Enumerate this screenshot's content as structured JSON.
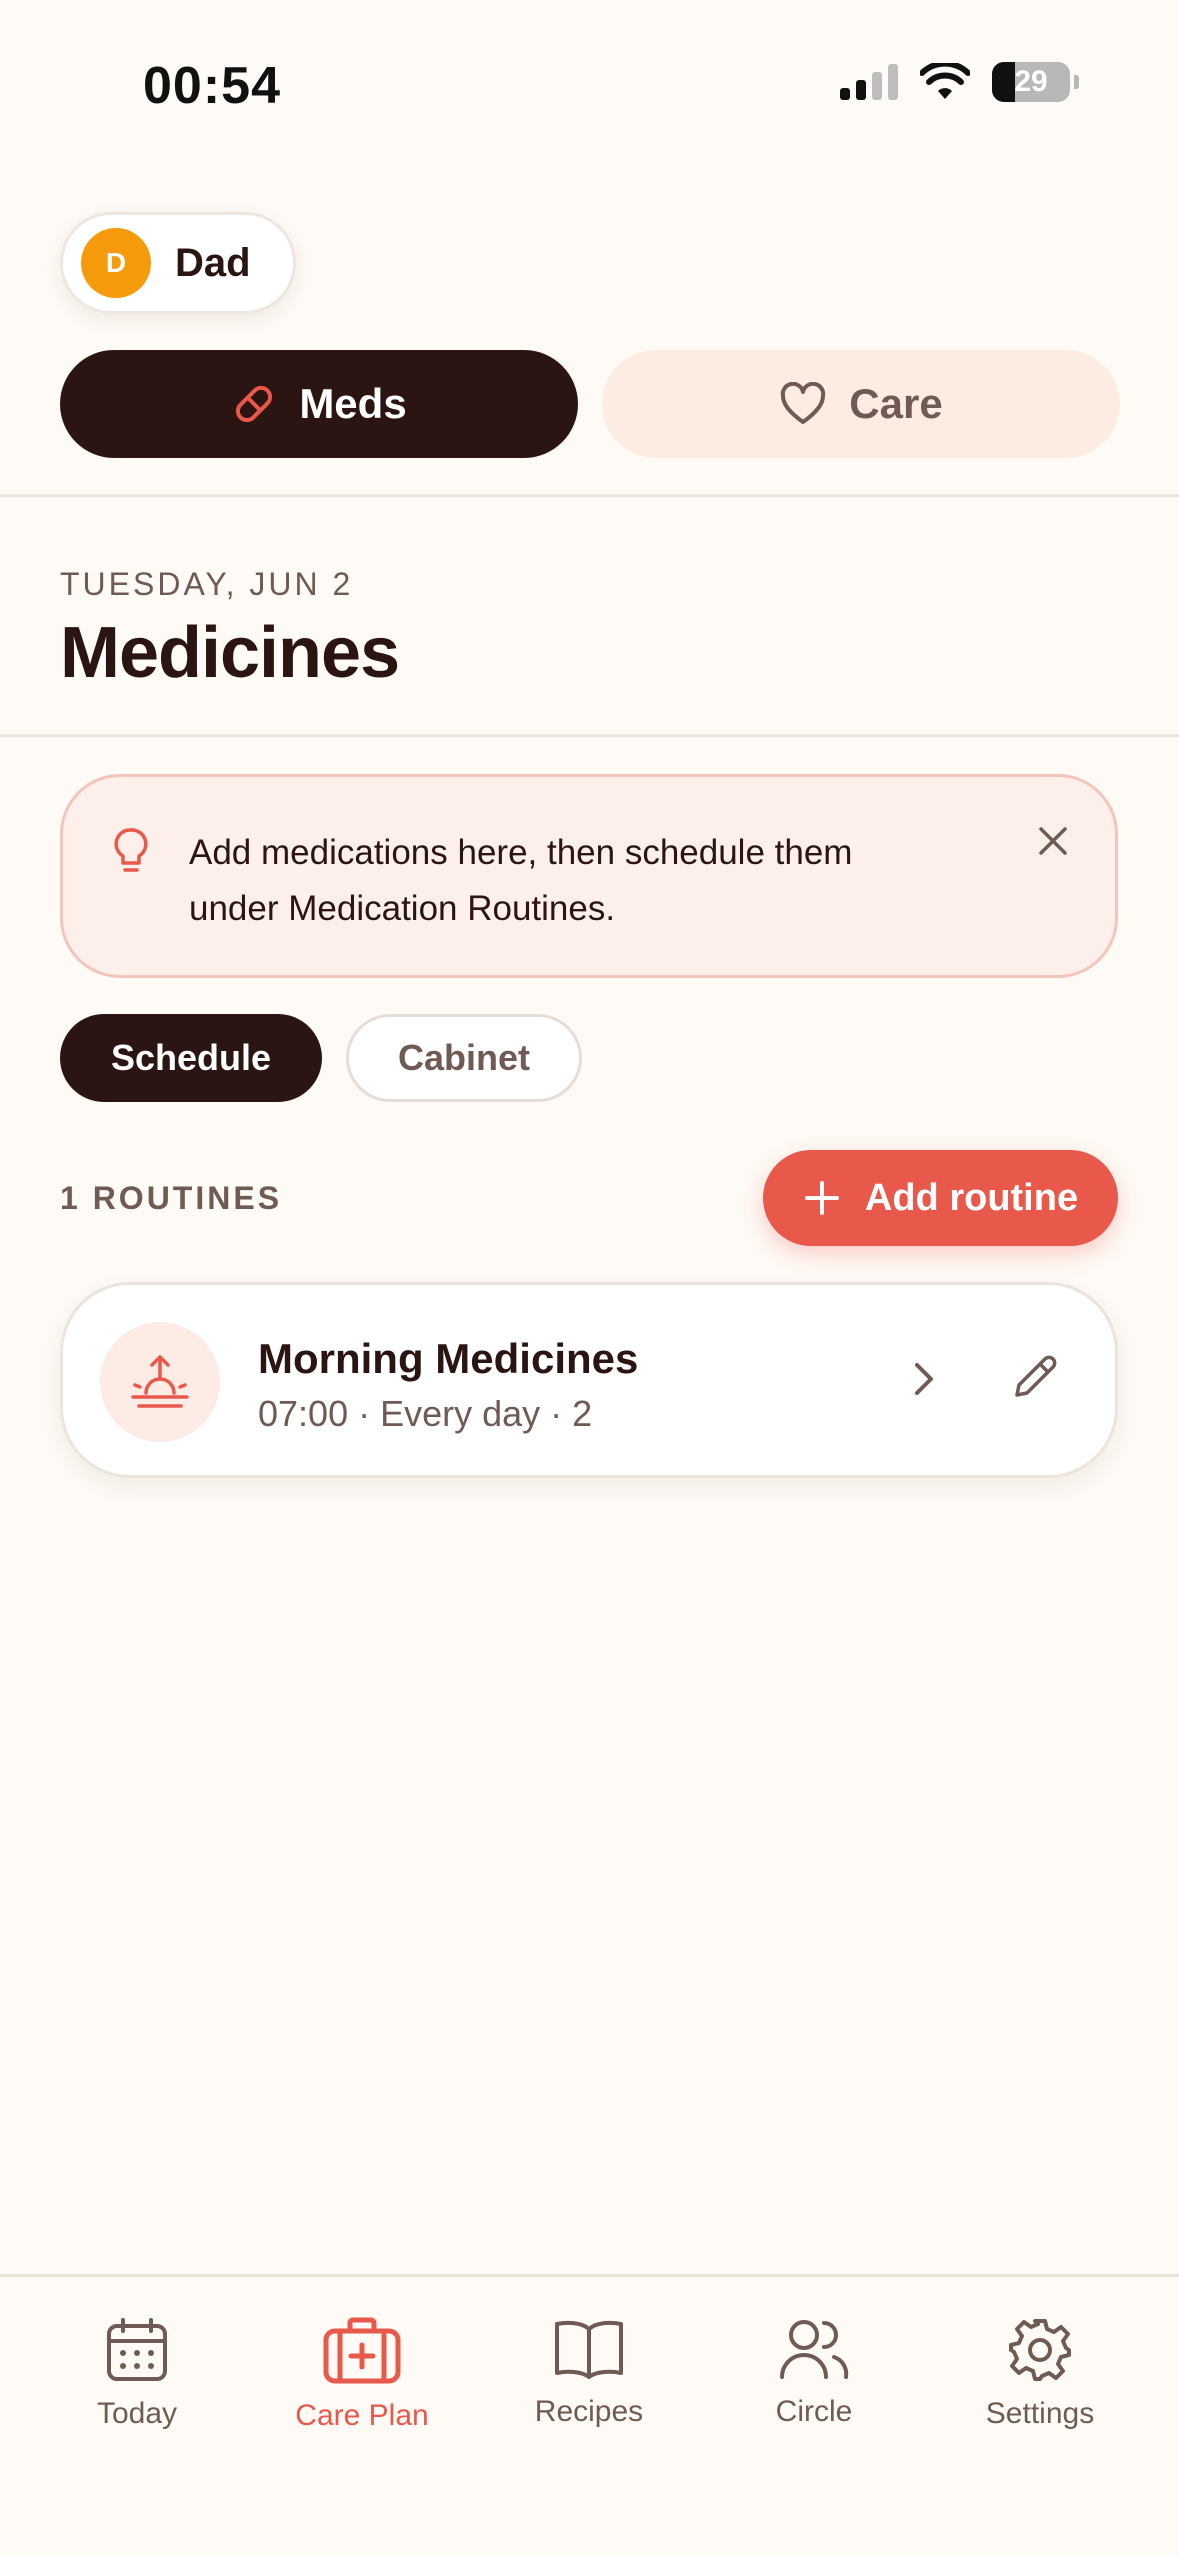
{
  "status_bar": {
    "time": "00:54",
    "battery": "29"
  },
  "profile": {
    "initial": "D",
    "name": "Dad"
  },
  "top_tabs": {
    "meds": "Meds",
    "care": "Care"
  },
  "header": {
    "date": "TUESDAY, JUN 2",
    "title": "Medicines"
  },
  "tip": {
    "text": "Add medications here, then schedule them under Medication Routines."
  },
  "sub_tabs": {
    "schedule": "Schedule",
    "cabinet": "Cabinet"
  },
  "routines": {
    "count_label": "1 ROUTINES",
    "add_label": "Add routine",
    "items": [
      {
        "title": "Morning Medicines",
        "subtitle": "07:00 · Every day · 2"
      }
    ]
  },
  "nav": {
    "today": "Today",
    "care_plan": "Care Plan",
    "recipes": "Recipes",
    "circle": "Circle",
    "settings": "Settings"
  },
  "colors": {
    "accent": "#e8584b",
    "dark": "#2b1512",
    "avatar": "#f59a0b",
    "background": "#fefaf5"
  }
}
